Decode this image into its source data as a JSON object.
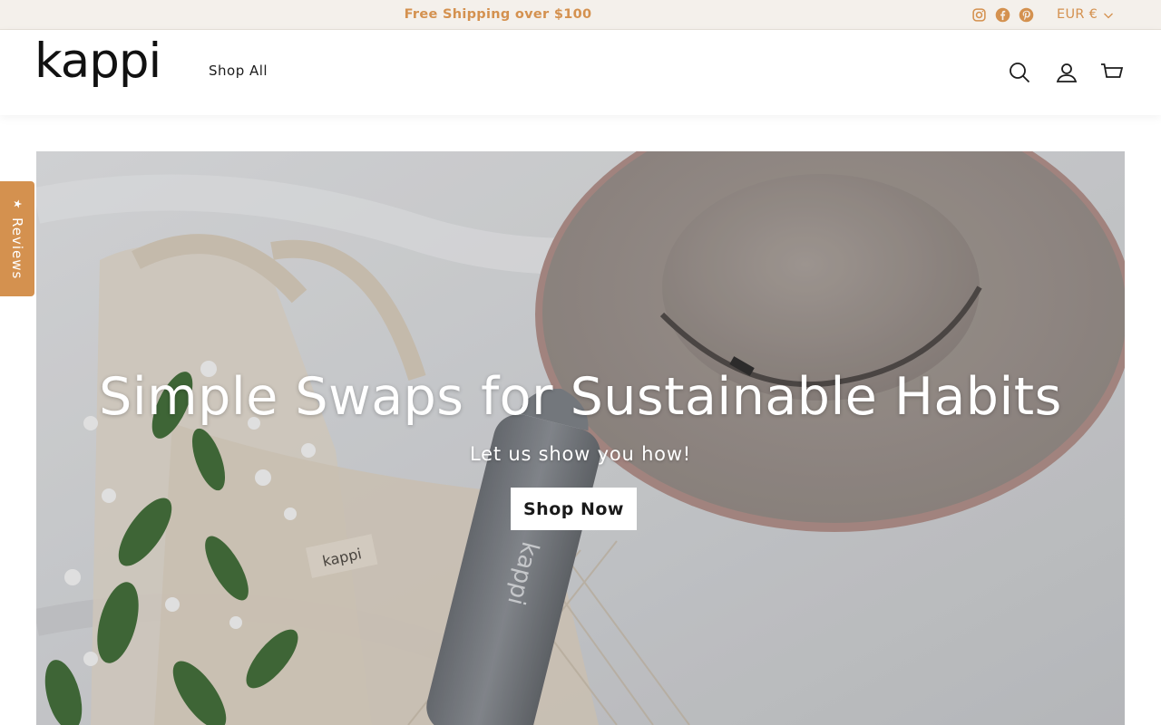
{
  "announcement": {
    "text": "Free Shipping over $100"
  },
  "social": [
    "instagram-icon",
    "facebook-icon",
    "pinterest-icon"
  ],
  "currency": {
    "selected": "EUR €"
  },
  "header": {
    "logo": "kappi",
    "nav": {
      "shop_all": "Shop All"
    },
    "icons": [
      "search-icon",
      "account-icon",
      "cart-icon"
    ]
  },
  "reviews_tab": {
    "label": "Reviews"
  },
  "hero": {
    "title": "Simple Swaps for Sustainable Habits",
    "subtitle": "Let us show you how!",
    "button": "Shop Now",
    "bottle_text": "kappi",
    "bag_tag_text": "kappi"
  },
  "colors": {
    "accent": "#d4914f",
    "announcement_bg": "#f4f0eb",
    "text": "#1c1c1c"
  }
}
